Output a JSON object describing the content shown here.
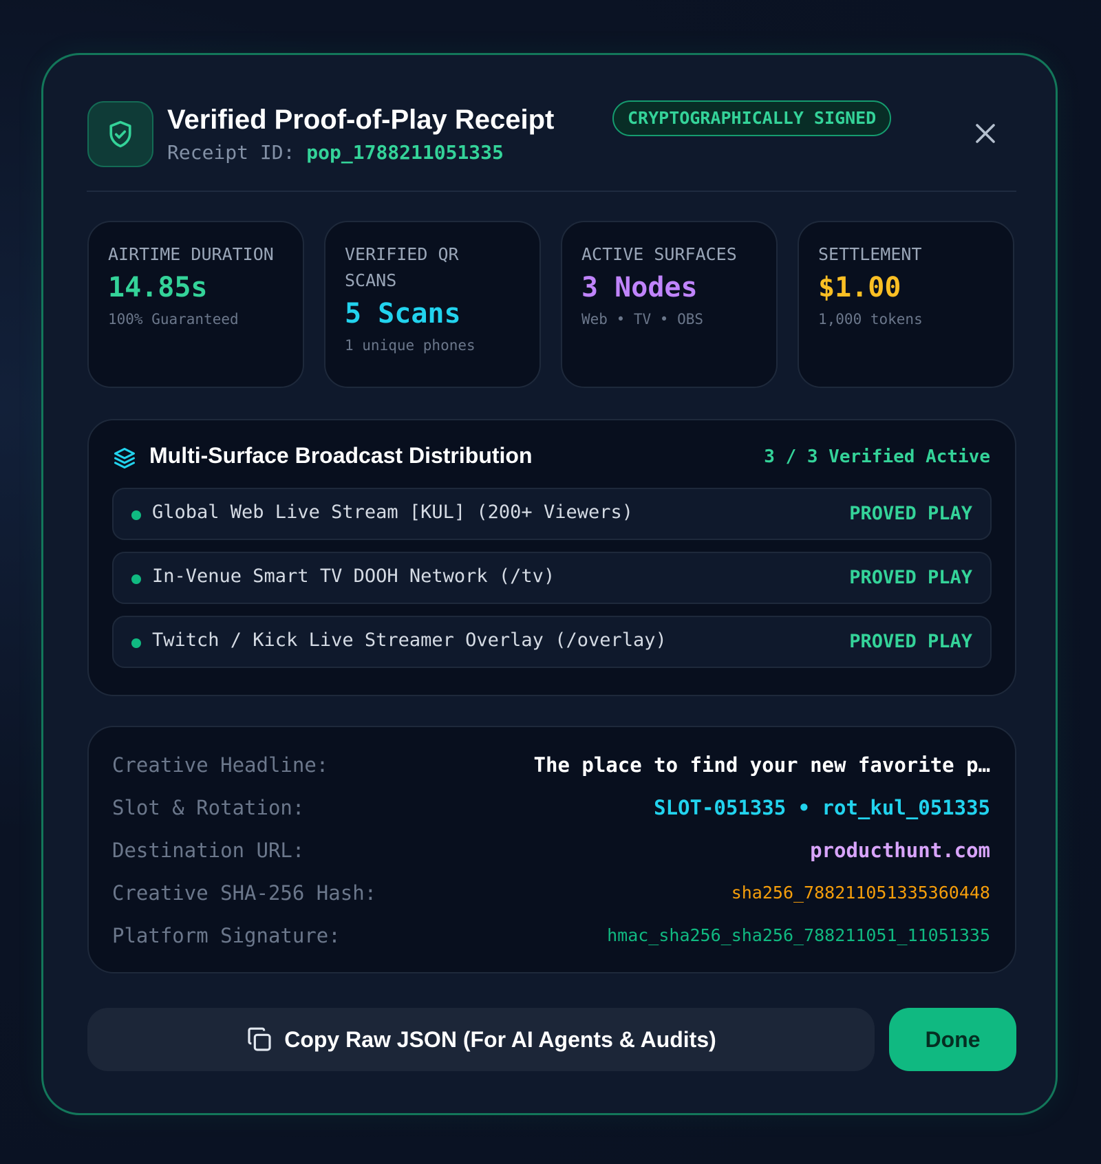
{
  "header": {
    "title": "Verified Proof-of-Play Receipt",
    "badge": "CRYPTOGRAPHICALLY SIGNED",
    "receipt_label": "Receipt ID: ",
    "receipt_id": "pop_1788211051335"
  },
  "stats": [
    {
      "label": "AIRTIME DURATION",
      "value": "14.85s",
      "sub": "100% Guaranteed",
      "color": "#34d399"
    },
    {
      "label": "VERIFIED QR SCANS",
      "value": "5 Scans",
      "sub": "1 unique phones",
      "color": "#22d3ee"
    },
    {
      "label": "ACTIVE SURFACES",
      "value": "3 Nodes",
      "sub": "Web • TV • OBS",
      "color": "#c084fc"
    },
    {
      "label": "SETTLEMENT",
      "value": "$1.00",
      "sub": "1,000 tokens",
      "color": "#fbbf24"
    }
  ],
  "distribution": {
    "title": "Multi-Surface Broadcast Distribution",
    "count": "3 / 3 Verified Active",
    "rows": [
      {
        "label": "Global Web Live Stream [KUL] (200+ Viewers)",
        "status": "PROVED PLAY"
      },
      {
        "label": "In-Venue Smart TV DOOH Network (/tv)",
        "status": "PROVED PLAY"
      },
      {
        "label": "Twitch / Kick Live Streamer Overlay (/overlay)",
        "status": "PROVED PLAY"
      }
    ]
  },
  "details": [
    {
      "key": "Creative Headline:",
      "value": "The place to find your new favorite p…",
      "color": "#ffffff"
    },
    {
      "key": "Slot & Rotation:",
      "value": "SLOT-051335 • rot_kul_051335",
      "color": "#22d3ee"
    },
    {
      "key": "Destination URL:",
      "value": "producthunt.com",
      "color": "#d8a4fb"
    },
    {
      "key": "Creative SHA-256 Hash:",
      "value": "sha256_788211051335360448",
      "color": "#f59e0b"
    },
    {
      "key": "Platform Signature:",
      "value": "hmac_sha256_sha256_788211051_11051335",
      "color": "#10b981"
    }
  ],
  "actions": {
    "copy_label": "Copy Raw JSON (For AI Agents & Audits)",
    "done_label": "Done"
  },
  "icons": {
    "header": "shield-check-icon",
    "close": "close-icon",
    "distribution": "layers-icon",
    "copy": "copy-icon"
  }
}
